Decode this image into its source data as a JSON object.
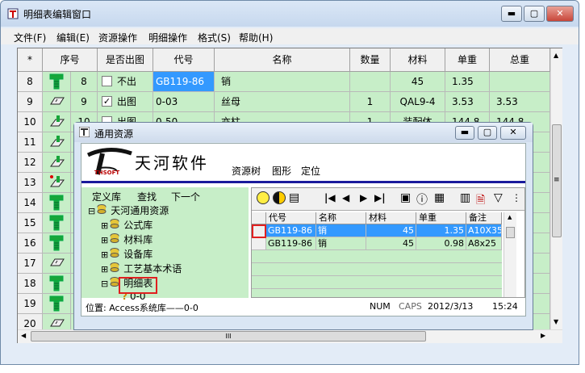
{
  "window": {
    "title": "明细表编辑窗口"
  },
  "menu": [
    "文件(F)",
    "编辑(E)",
    "资源操作",
    "明细操作",
    "格式(S)",
    "帮助(H)"
  ],
  "grid": {
    "headers": [
      "*",
      "序号",
      "是否出图",
      "代号",
      "名称",
      "数量",
      "材料",
      "单重",
      "总重"
    ],
    "rows": [
      {
        "n": "8",
        "icon": "bolt-icon",
        "seq": "8",
        "checked": false,
        "draw": "不出",
        "code": "GB119-86",
        "name": "销",
        "qty": "",
        "mat": "45",
        "unit": "1.35",
        "total": ""
      },
      {
        "n": "9",
        "icon": "washer-icon",
        "seq": "9",
        "checked": true,
        "draw": "出图",
        "code": "0-03",
        "name": "丝母",
        "qty": "1",
        "mat": "QAL9-4",
        "unit": "3.53",
        "total": "3.53"
      },
      {
        "n": "10",
        "icon": "assembly-icon",
        "seq": "10",
        "checked": false,
        "draw": "出图",
        "code": "0-50",
        "name": "亦柱",
        "qty": "1",
        "mat": "装配体",
        "unit": "144.8",
        "total": "144.8"
      },
      {
        "n": "11",
        "icon": "assembly-icon"
      },
      {
        "n": "12",
        "icon": "assembly-icon"
      },
      {
        "n": "13",
        "icon": "assembly-red-icon"
      },
      {
        "n": "14",
        "icon": "bolt-icon"
      },
      {
        "n": "15",
        "icon": "bolt-icon"
      },
      {
        "n": "16",
        "icon": "bolt-icon"
      },
      {
        "n": "17",
        "icon": "washer-icon"
      },
      {
        "n": "18",
        "icon": "bolt-icon"
      },
      {
        "n": "19",
        "icon": "bolt-icon"
      },
      {
        "n": "20",
        "icon": "washer-icon"
      }
    ]
  },
  "dialog": {
    "title": "通用资源",
    "brand": "天河软件",
    "brand_sub": "THSOFT",
    "nav": [
      "资源树",
      "图形",
      "定位"
    ],
    "tree_toolbar": [
      "定义库",
      "查找",
      "下一个"
    ],
    "tree": [
      {
        "label": "天河通用资源",
        "exp": "⊟"
      },
      {
        "label": "公式库",
        "exp": "⊞"
      },
      {
        "label": "材料库",
        "exp": "⊞"
      },
      {
        "label": "设备库",
        "exp": "⊞"
      },
      {
        "label": "工艺基本术语",
        "exp": "⊞"
      },
      {
        "label": "明细表",
        "exp": "⊟"
      },
      {
        "label": "0-0",
        "exp": ""
      }
    ],
    "grid_headers": [
      "代号",
      "名称",
      "材料",
      "单重",
      "备注"
    ],
    "grid_rows": [
      {
        "code": "GB119-86",
        "name": "销",
        "mat": "45",
        "unit": "1.35",
        "note": "A10X35"
      },
      {
        "code": "GB119-86",
        "name": "销",
        "mat": "45",
        "unit": "0.98",
        "note": "A8x25"
      }
    ],
    "status": {
      "path": "位置: Access系统库——0-0",
      "num": "NUM",
      "caps": "CAPS",
      "date": "2012/3/13",
      "time": "15:24"
    }
  },
  "colors": {
    "grid_bg": "#c7eec8",
    "selection": "#3399ff",
    "brand_rule": "#1a1a9c"
  }
}
